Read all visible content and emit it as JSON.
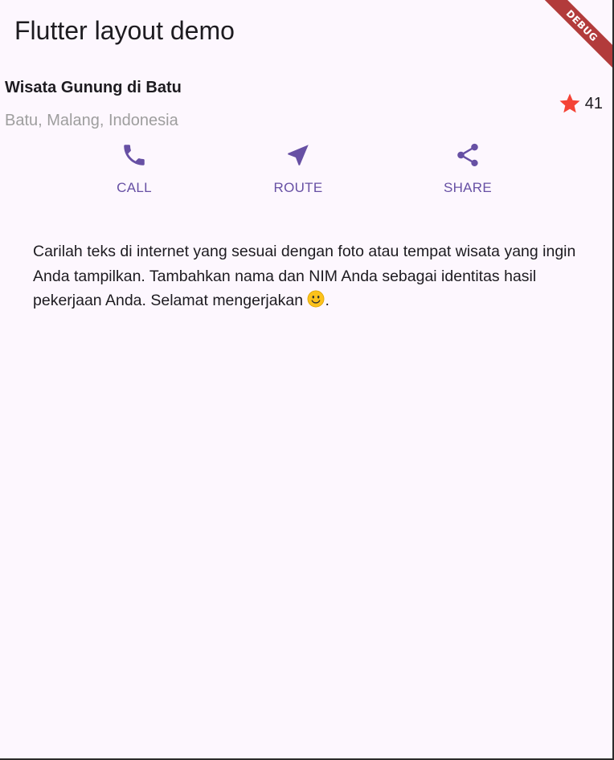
{
  "app": {
    "title": "Flutter layout demo",
    "debug_banner": "DEBUG"
  },
  "place": {
    "name": "Wisata Gunung di Batu",
    "location": "Batu, Malang, Indonesia",
    "rating_count": "41",
    "rating_icon": "star-icon",
    "rating_color": "#f44336"
  },
  "actions": [
    {
      "label": "CALL",
      "icon": "phone-icon"
    },
    {
      "label": "ROUTE",
      "icon": "navigation-arrow-icon"
    },
    {
      "label": "SHARE",
      "icon": "share-icon"
    }
  ],
  "accent_color": "#6750a4",
  "description": "Carilah teks di internet yang sesuai dengan foto atau tempat wisata yang ingin Anda tampilkan. Tambahkan nama dan NIM Anda sebagai identitas hasil pekerjaan Anda. Selamat mengerjakan",
  "description_suffix": "."
}
